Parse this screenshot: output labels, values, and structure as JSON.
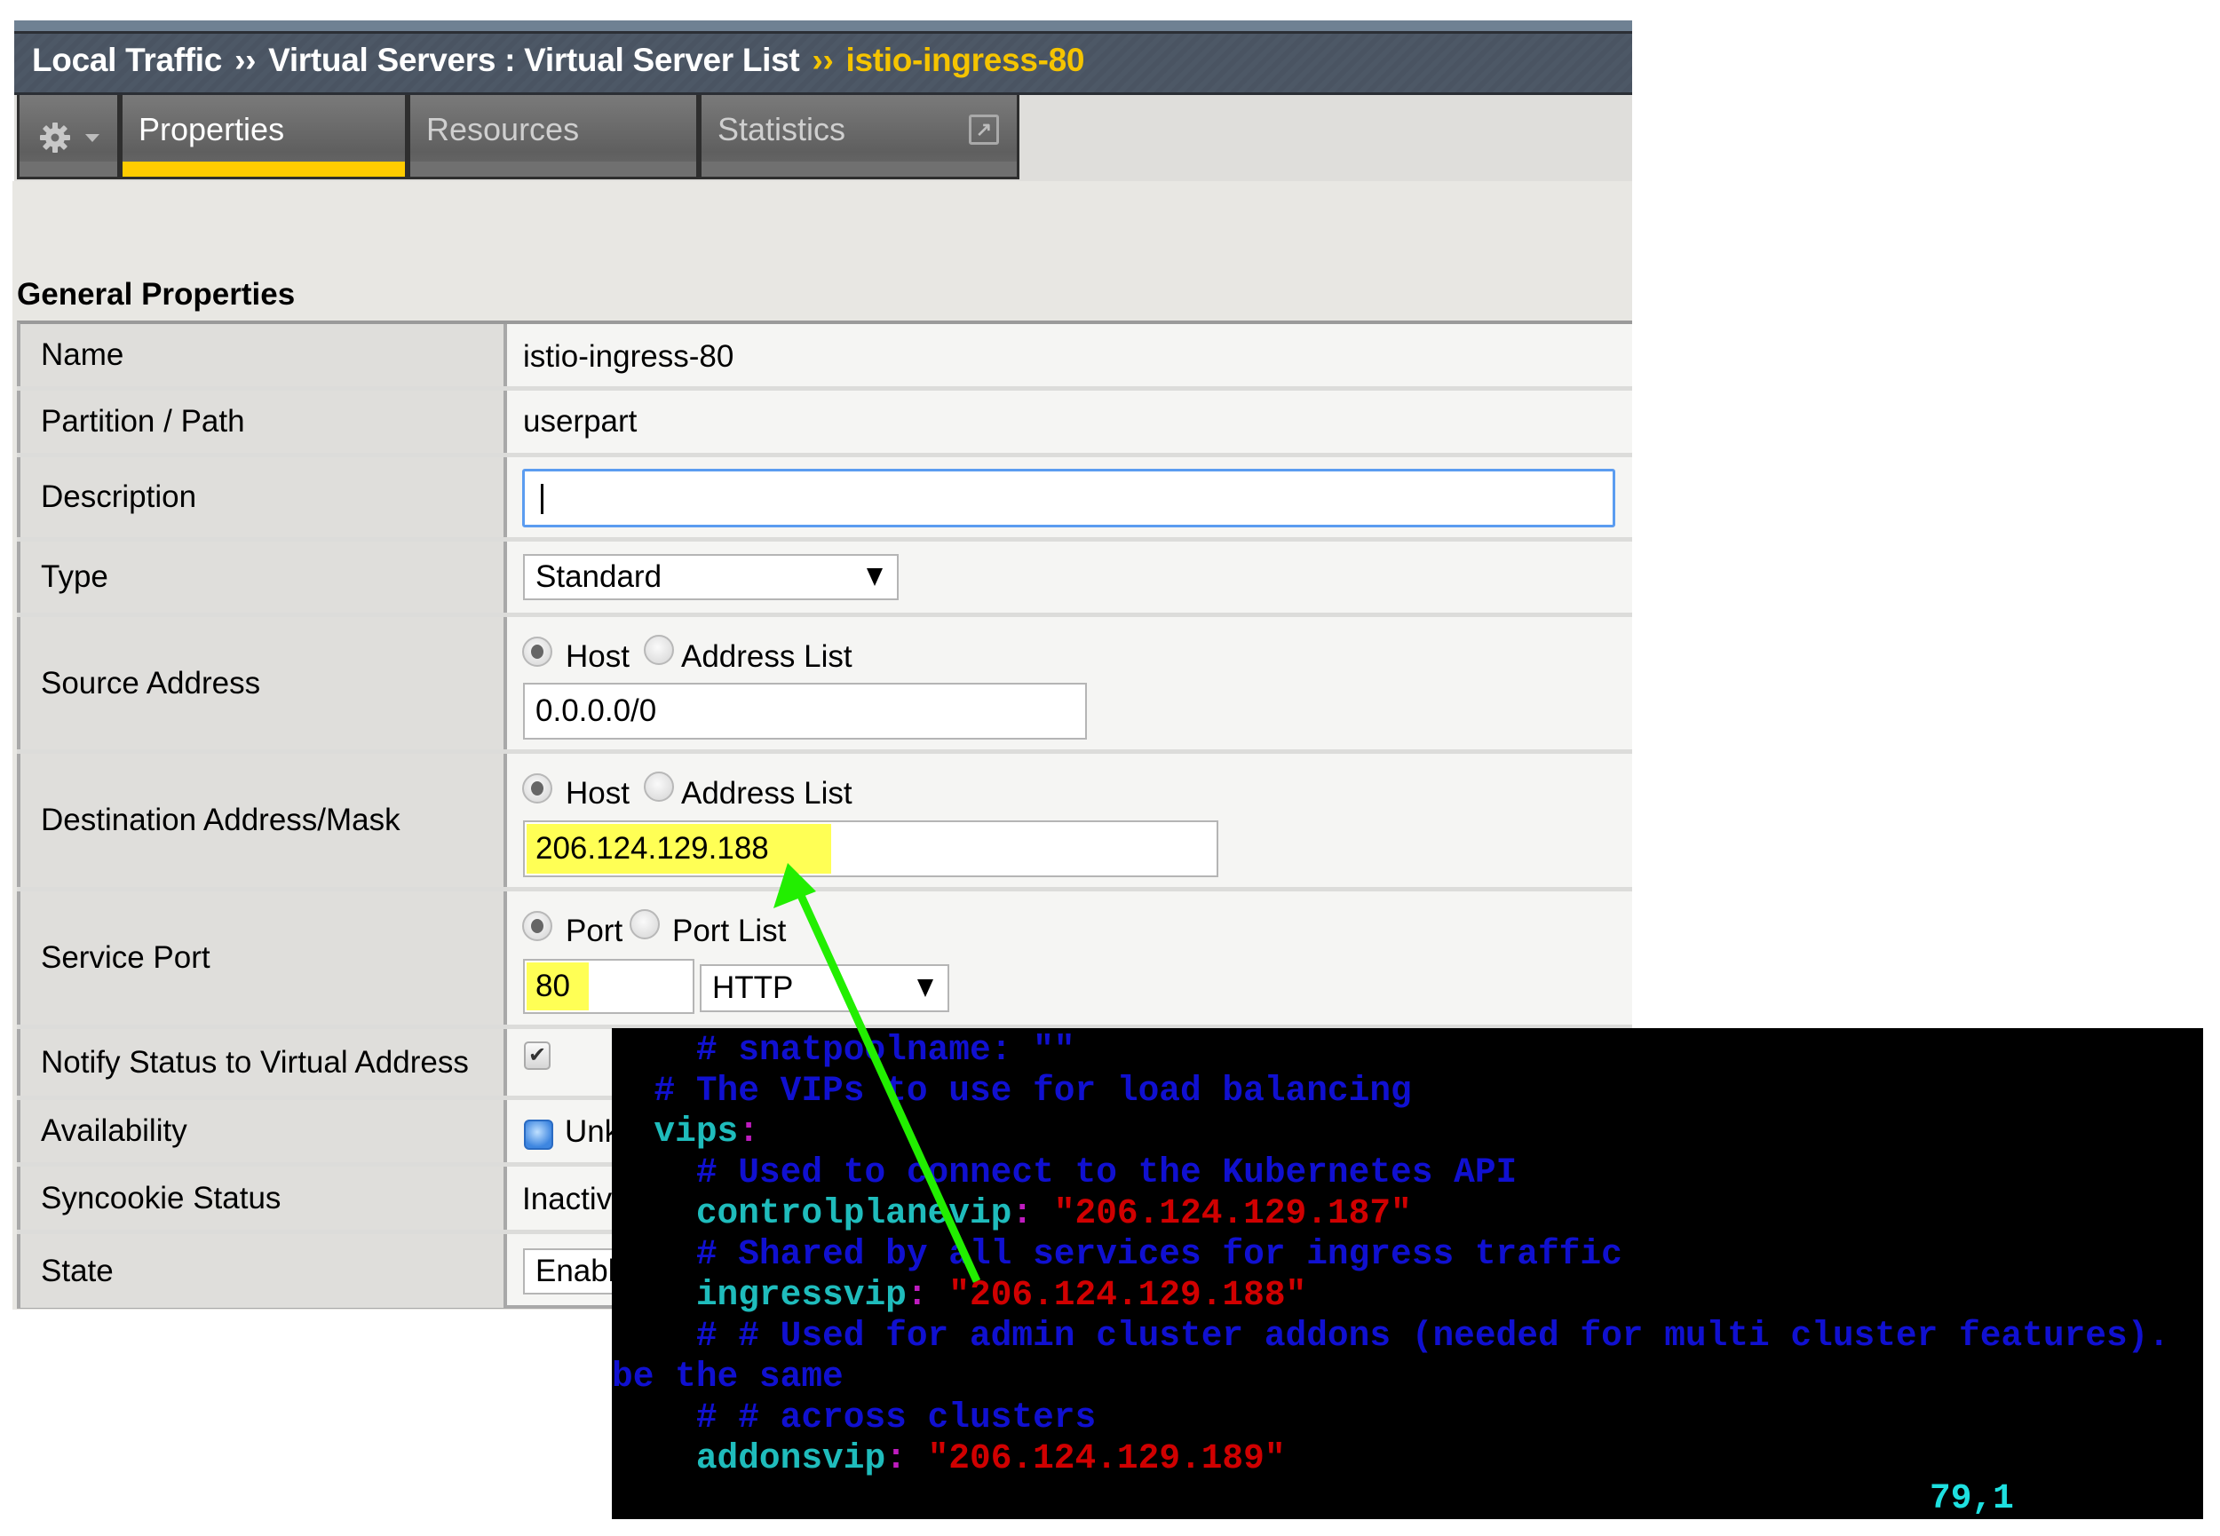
{
  "breadcrumb": {
    "items": [
      "Local Traffic",
      "Virtual Servers : Virtual Server List"
    ],
    "separator": "››",
    "current": "istio-ingress-80",
    "current_color": "#f5c400"
  },
  "tabs": {
    "gear_icon": "gear-icon",
    "items": [
      {
        "label": "Properties",
        "active": true
      },
      {
        "label": "Resources",
        "active": false
      },
      {
        "label": "Statistics",
        "active": false,
        "icon": "popout-icon"
      }
    ],
    "popout_glyph": "↗"
  },
  "section_title": "General Properties",
  "properties": {
    "name": {
      "label": "Name",
      "value": "istio-ingress-80"
    },
    "partition": {
      "label": "Partition / Path",
      "value": "userpart"
    },
    "description": {
      "label": "Description",
      "value": ""
    },
    "type": {
      "label": "Type",
      "value": "Standard"
    },
    "source_address": {
      "label": "Source Address",
      "radio_host": "Host",
      "radio_list": "Address List",
      "selected": "Host",
      "value": "0.0.0.0/0"
    },
    "destination": {
      "label": "Destination Address/Mask",
      "radio_host": "Host",
      "radio_list": "Address List",
      "selected": "Host",
      "value": "206.124.129.188"
    },
    "service_port": {
      "label": "Service Port",
      "radio_port": "Port",
      "radio_list": "Port List",
      "selected": "Port",
      "value": "80",
      "protocol": "HTTP"
    },
    "notify": {
      "label": "Notify Status to Virtual Address",
      "checked": true,
      "check_glyph": "✔"
    },
    "availability": {
      "label": "Availability",
      "value_visible": "Unk"
    },
    "syncookie": {
      "label": "Syncookie Status",
      "value_visible": "Inactiv"
    },
    "state": {
      "label": "State",
      "value_visible": "Enabl"
    }
  },
  "highlight_color": "#ffff55",
  "terminal": {
    "lines": [
      [
        {
          "t": "    # snatpoolname: \"\"",
          "c": "comment"
        }
      ],
      [
        {
          "t": "  # The VIPs to use for load balancing",
          "c": "comment"
        }
      ],
      [
        {
          "t": "  vips",
          "c": "key"
        },
        {
          "t": ":",
          "c": "colon"
        }
      ],
      [
        {
          "t": "    # Used to connect to the Kubernetes API",
          "c": "comment"
        }
      ],
      [
        {
          "t": "    controlplanevip",
          "c": "key"
        },
        {
          "t": ":",
          "c": "colon"
        },
        {
          "t": " \"206.124.129.187\"",
          "c": "str"
        }
      ],
      [
        {
          "t": "    # Shared by all services for ingress traffic",
          "c": "comment"
        }
      ],
      [
        {
          "t": "    ingressvip",
          "c": "key"
        },
        {
          "t": ":",
          "c": "colon"
        },
        {
          "t": " \"206.124.129.188\"",
          "c": "str"
        }
      ],
      [
        {
          "t": "    # # Used for admin cluster addons (needed for multi cluster features).",
          "c": "comment"
        }
      ],
      [
        {
          "t": "be the same",
          "c": "comment"
        }
      ],
      [
        {
          "t": "    # # across clusters",
          "c": "comment"
        }
      ],
      [
        {
          "t": "    addonsvip",
          "c": "key"
        },
        {
          "t": ":",
          "c": "colon"
        },
        {
          "t": " \"206.124.129.189\"",
          "c": "str"
        }
      ]
    ],
    "status": "79,1",
    "colors": {
      "comment": "#1010d0",
      "key": "#1fbcbc",
      "colon": "#c01cc0",
      "str": "#d00000",
      "status": "#1ee0e0"
    }
  },
  "annotation": {
    "type": "arrow",
    "color": "#22ee00",
    "from": "terminal ingressvip value",
    "to": "destination address field"
  }
}
